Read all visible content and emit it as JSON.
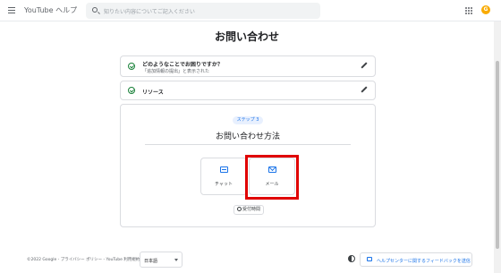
{
  "header": {
    "app_title": "YouTube ヘルプ",
    "search_placeholder": "知りたい内容についてご記入ください",
    "avatar_letter": "G"
  },
  "page": {
    "title": "お問い合わせ"
  },
  "steps": [
    {
      "title": "どのようなことでお困りですか？",
      "subtitle": "「追加情報の提出」と表示された"
    },
    {
      "title": "リソース",
      "subtitle": ""
    }
  ],
  "contact": {
    "step_label": "ステップ 3",
    "title": "お問い合わせ方法",
    "options": [
      {
        "label": "チャット",
        "icon": "chat-icon"
      },
      {
        "label": "メール",
        "icon": "mail-icon"
      }
    ],
    "hours_label": "受付時間"
  },
  "footer": {
    "text": "©2022 Google - プライバシー ポリシー - YouTube 利用規約",
    "language": "日本語",
    "feedback_label": "ヘルプセンターに関するフィードバックを送信"
  },
  "colors": {
    "accent": "#1a73e8",
    "check": "#188038",
    "highlight": "#e00000"
  }
}
